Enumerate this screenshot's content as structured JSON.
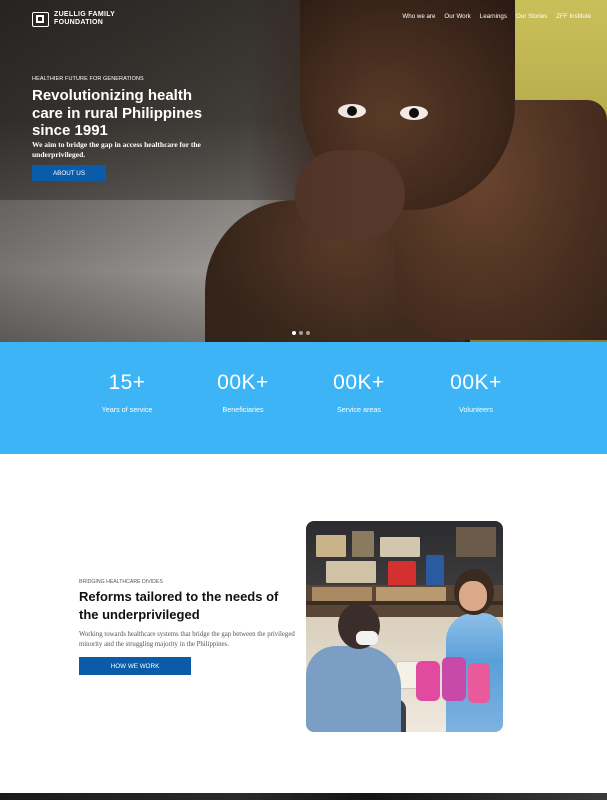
{
  "brand": {
    "name_line1": "Zuellig Family",
    "name_line2": "Foundation"
  },
  "nav": {
    "items": [
      {
        "label": "Who we are"
      },
      {
        "label": "Our Work"
      },
      {
        "label": "Learnings"
      },
      {
        "label": "Our Stories"
      },
      {
        "label": "ZFF Institute"
      }
    ]
  },
  "hero": {
    "eyebrow": "HEALTHIER FUTURE FOR GENERATIONS",
    "title": "Revolutionizing health care in rural Philippines since 1991",
    "subtitle": "We aim to bridge the gap in access healthcare for the underprivileged.",
    "button_label": "ABOUT US",
    "slides_total": 3,
    "slide_active": 1
  },
  "stats": {
    "background": "#3db4f5",
    "items": [
      {
        "value": "15+",
        "label": "Years of service"
      },
      {
        "value": "00K+",
        "label": "Beneficiaries"
      },
      {
        "value": "00K+",
        "label": "Service areas"
      },
      {
        "value": "00K+",
        "label": "Volunteers"
      }
    ]
  },
  "reforms": {
    "eyebrow": "BRIDGING HEALTHCARE DIVIDES",
    "title": "Reforms tailored to the needs of the underprivileged",
    "body": "Working towards healthcare systems that bridge the gap between the privileged minority and the struggling majority in the Philippines.",
    "button_label": "HOW WE WORK"
  },
  "colors": {
    "primary_button": "#0a5ca8",
    "stats_band": "#3db4f5"
  }
}
